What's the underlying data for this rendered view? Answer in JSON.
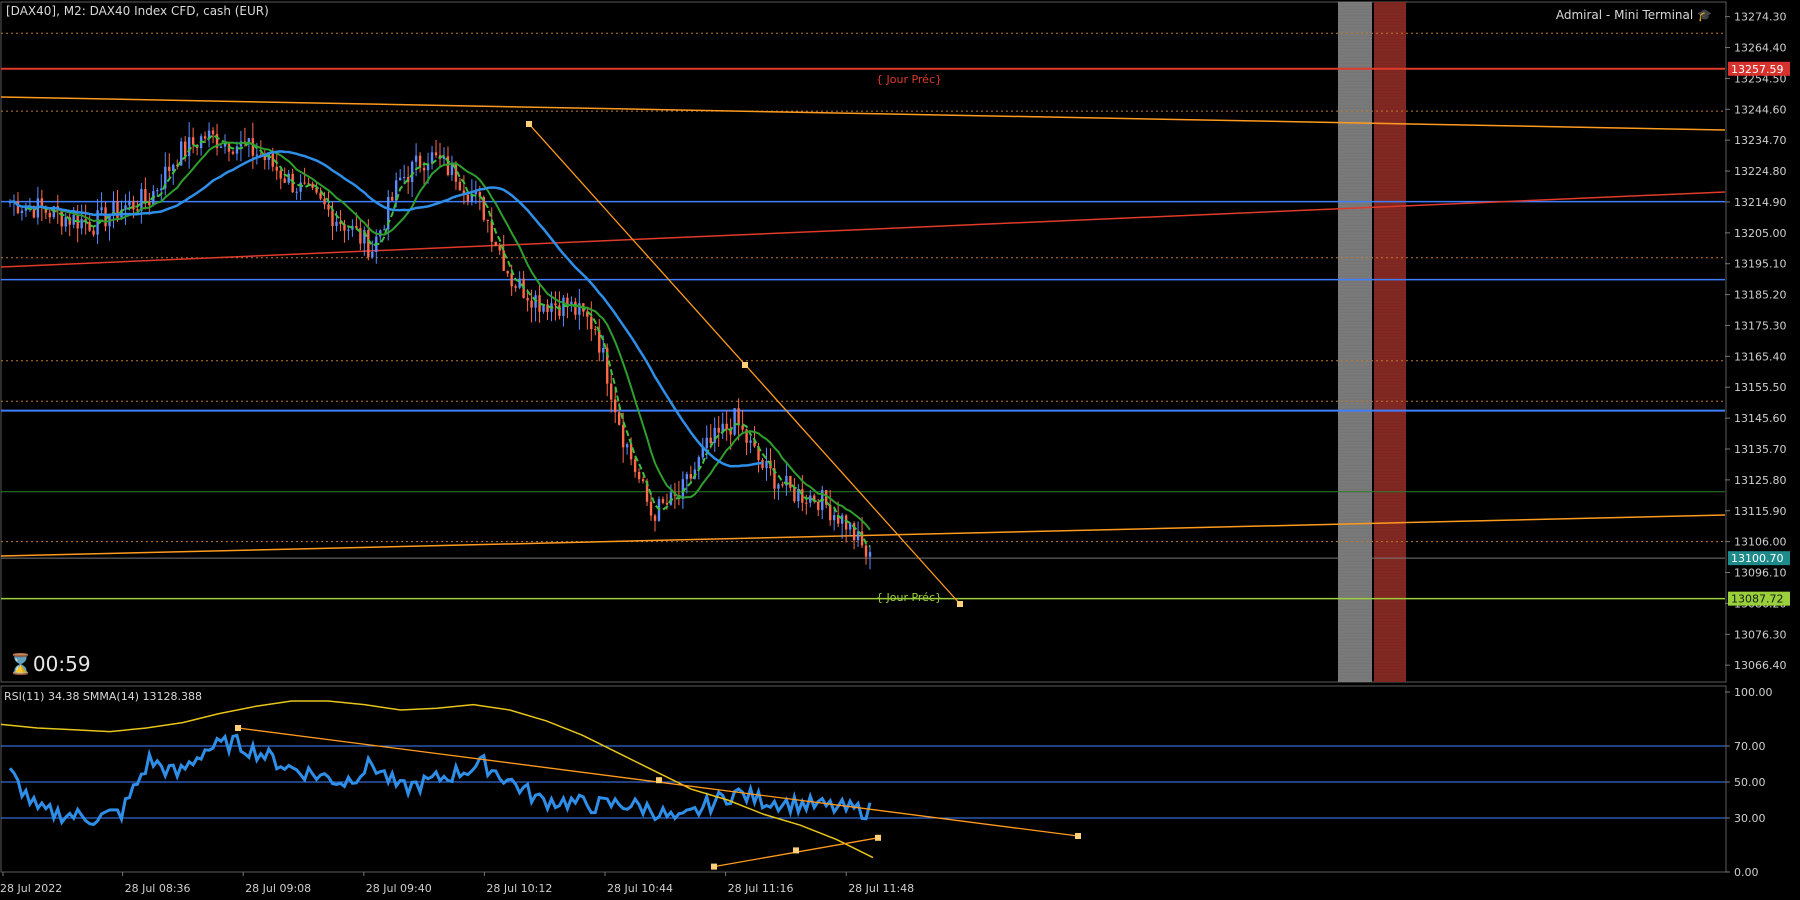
{
  "header": {
    "symbol": "[DAX40], M2:  DAX40 Index CFD, cash (EUR)",
    "terminal": "Admiral - Mini Terminal"
  },
  "timer": "00:59",
  "labels": {
    "prev_day_high": "{ Jour Préc}",
    "prev_day_low": "{ Jour Préc}"
  },
  "price_axis": {
    "ticks": [
      "13274.30",
      "13264.40",
      "13254.50",
      "13244.60",
      "13234.70",
      "13224.80",
      "13214.90",
      "13205.00",
      "13195.10",
      "13185.20",
      "13175.30",
      "13165.40",
      "13155.50",
      "13145.60",
      "13135.70",
      "13125.80",
      "13115.90",
      "13106.00",
      "13096.10",
      "13086.20",
      "13076.30",
      "13066.40"
    ],
    "badges": [
      {
        "text": "13257.59",
        "color": "#d7322e"
      },
      {
        "text": "13100.70",
        "color": "#1f8a8a"
      },
      {
        "text": "13087.72",
        "color": "#9bcf3c"
      }
    ]
  },
  "time_axis": [
    "28 Jul 2022",
    "28 Jul 08:36",
    "28 Jul 09:08",
    "28 Jul 09:40",
    "28 Jul 10:12",
    "28 Jul 10:44",
    "28 Jul 11:16",
    "28 Jul 11:48"
  ],
  "rsi": {
    "header": "RSI(11) 34.38 SMMA(14) 13128.388",
    "ticks": [
      "100.00",
      "70.00",
      "50.00",
      "30.00",
      "0.00"
    ]
  },
  "colors": {
    "bull": "#5b8cff",
    "bear": "#ff6a4a",
    "ma_green": "#2f9e2f",
    "ma_dash": "#3fbf3f",
    "ma_blue": "#2f8fe8",
    "orange": "#ff9a1f",
    "red": "#e03a2a",
    "level_blue": "#3f7fff"
  },
  "chart_data": {
    "type": "candlestick",
    "x": [
      "28 Jul 2022",
      "28 Jul 08:36",
      "28 Jul 09:08",
      "28 Jul 09:40",
      "28 Jul 10:12",
      "28 Jul 10:44",
      "28 Jul 11:16",
      "28 Jul 11:48"
    ],
    "ylim": [
      13061,
      13279
    ],
    "price_path": [
      13215,
      13213,
      13210,
      13208,
      13213,
      13216,
      13230,
      13236,
      13234,
      13230,
      13222,
      13215,
      13208,
      13200,
      13222,
      13230,
      13224,
      13212,
      13190,
      13183,
      13182,
      13175,
      13140,
      13115,
      13120,
      13136,
      13145,
      13130,
      13122,
      13120,
      13112,
      13098
    ],
    "rsi_ylim": [
      0,
      100
    ],
    "rsi_path": [
      55,
      34,
      32,
      30,
      33,
      62,
      54,
      68,
      72,
      66,
      58,
      54,
      50,
      60,
      46,
      50,
      55,
      60,
      50,
      40,
      39,
      37,
      38,
      35,
      28,
      37,
      44,
      40,
      38,
      37,
      35,
      34
    ]
  }
}
